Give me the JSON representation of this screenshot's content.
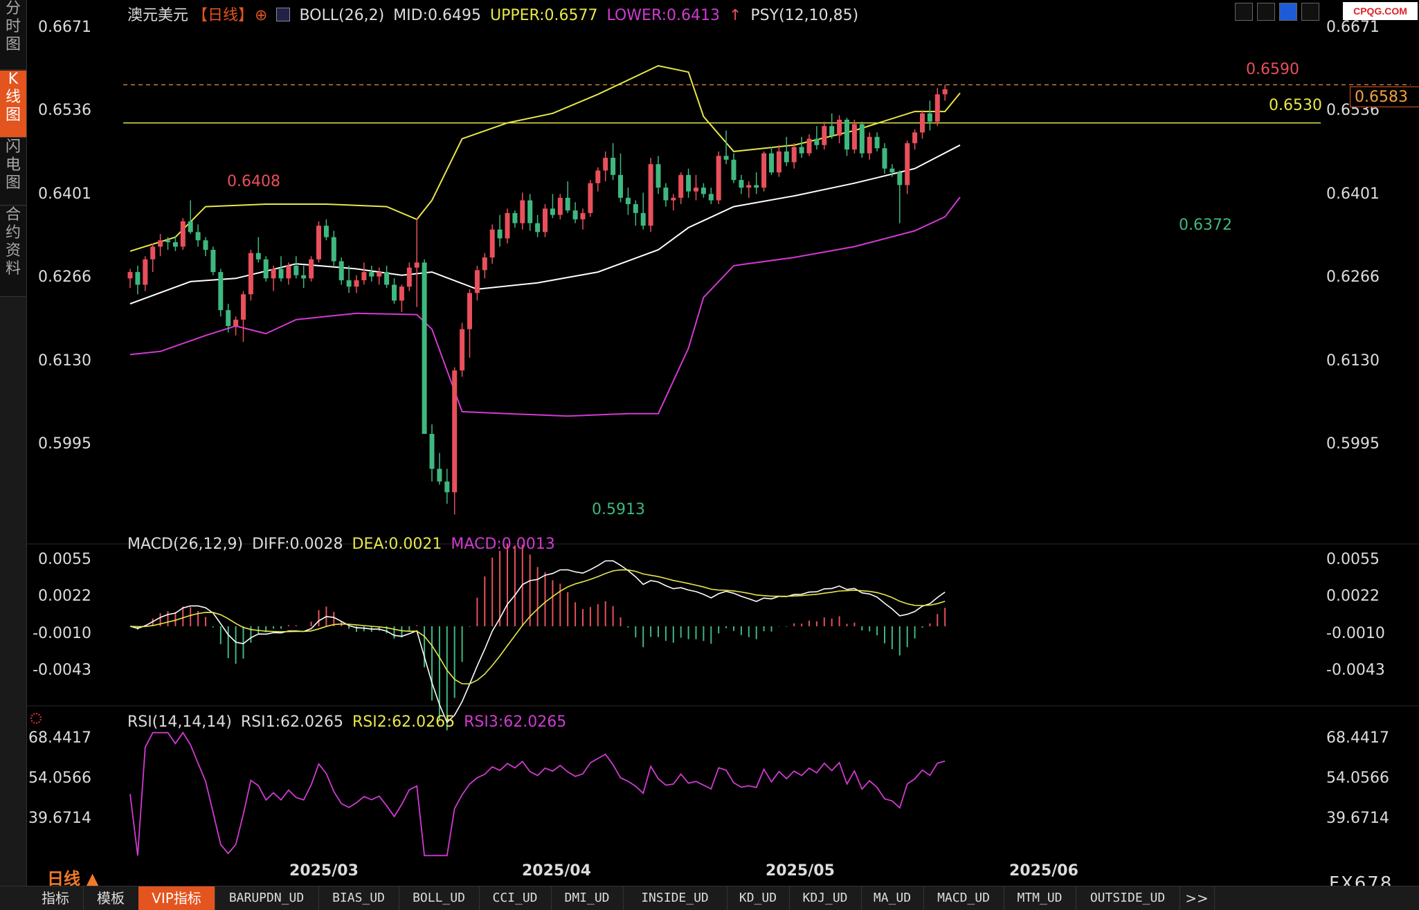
{
  "sidebar": {
    "tabs": [
      {
        "label": "分时图",
        "active": false
      },
      {
        "label": "K线图",
        "active": true
      },
      {
        "label": "闪电图",
        "active": false
      },
      {
        "label": "合约资料",
        "active": false
      }
    ]
  },
  "header": {
    "symbol": "澳元美元",
    "period_tag": "【日线】",
    "indicator_label": "BOLL(26,2)",
    "mid": "MID:0.6495",
    "upper": "UPPER:0.6577",
    "lower": "LOWER:0.6413",
    "psy": "PSY(12,10,85)",
    "logo": "CPQG.COM"
  },
  "price_axis": {
    "ticks": [
      "0.6671",
      "0.6536",
      "0.6401",
      "0.6266",
      "0.6130",
      "0.5995"
    ]
  },
  "annotations": {
    "high_label": "0.6408",
    "low_label": "0.5913",
    "recent_high_label": "0.6590",
    "recent_low_label": "0.6372",
    "hline_label": "0.6530",
    "last_price": "0.6583"
  },
  "macd": {
    "title": "MACD(26,12,9)",
    "diff": "DIFF:0.0028",
    "dea": "DEA:0.0021",
    "macd": "MACD:0.0013",
    "ticks": [
      "0.0055",
      "0.0022",
      "-0.0010",
      "-0.0043"
    ]
  },
  "rsi": {
    "title": "RSI(14,14,14)",
    "rsi1": "RSI1:62.0265",
    "rsi2": "RSI2:62.0265",
    "rsi3": "RSI3:62.0265",
    "ticks": [
      "68.4417",
      "54.0566",
      "39.6714"
    ]
  },
  "dates": [
    "2025/03",
    "2025/04",
    "2025/05",
    "2025/06"
  ],
  "period_label": "日线 ▲",
  "watermark": "FX678",
  "bottom_bar": [
    "指标",
    "模板",
    "VIP指标",
    "BARUPDN_UD",
    "BIAS_UD",
    "BOLL_UD",
    "CCI_UD",
    "DMI_UD",
    "INSIDE_UD",
    "KD_UD",
    "KDJ_UD",
    "MA_UD",
    "MACD_UD",
    "MTM_UD",
    "OUTSIDE_UD",
    ">>"
  ],
  "colors": {
    "up": "#e8505b",
    "down": "#3fb87f",
    "mid": "#ffffff",
    "upper": "#e8e84a",
    "lower": "#d23ad2",
    "accent": "#e4541e"
  },
  "chart_data": {
    "type": "candlestick",
    "price_range": [
      0.5895,
      0.668
    ],
    "candles_ohlc": [
      [
        0.6285,
        0.63,
        0.627,
        0.6295
      ],
      [
        0.6295,
        0.6305,
        0.626,
        0.6275
      ],
      [
        0.6275,
        0.632,
        0.6265,
        0.6315
      ],
      [
        0.6315,
        0.634,
        0.6295,
        0.6335
      ],
      [
        0.6335,
        0.6355,
        0.632,
        0.6345
      ],
      [
        0.6345,
        0.635,
        0.633,
        0.6342
      ],
      [
        0.6342,
        0.6352,
        0.6328,
        0.6335
      ],
      [
        0.6335,
        0.638,
        0.633,
        0.6375
      ],
      [
        0.6375,
        0.6408,
        0.6355,
        0.6358
      ],
      [
        0.6358,
        0.637,
        0.6335,
        0.6345
      ],
      [
        0.6345,
        0.635,
        0.632,
        0.633
      ],
      [
        0.633,
        0.6335,
        0.629,
        0.6295
      ],
      [
        0.6295,
        0.63,
        0.6225,
        0.6235
      ],
      [
        0.6235,
        0.6245,
        0.62,
        0.621
      ],
      [
        0.621,
        0.6225,
        0.6195,
        0.622
      ],
      [
        0.622,
        0.6265,
        0.6185,
        0.626
      ],
      [
        0.626,
        0.633,
        0.625,
        0.6325
      ],
      [
        0.6325,
        0.635,
        0.631,
        0.6315
      ],
      [
        0.6315,
        0.632,
        0.628,
        0.6285
      ],
      [
        0.6285,
        0.6305,
        0.6265,
        0.63
      ],
      [
        0.63,
        0.632,
        0.628,
        0.6285
      ],
      [
        0.6285,
        0.631,
        0.6275,
        0.6305
      ],
      [
        0.6305,
        0.632,
        0.6285,
        0.629
      ],
      [
        0.629,
        0.6305,
        0.627,
        0.6285
      ],
      [
        0.6285,
        0.632,
        0.628,
        0.6315
      ],
      [
        0.6315,
        0.6375,
        0.631,
        0.6368
      ],
      [
        0.6368,
        0.6378,
        0.6345,
        0.635
      ],
      [
        0.635,
        0.636,
        0.6305,
        0.6312
      ],
      [
        0.6312,
        0.6318,
        0.6275,
        0.6282
      ],
      [
        0.6282,
        0.6305,
        0.6262,
        0.6272
      ],
      [
        0.6272,
        0.629,
        0.6262,
        0.6282
      ],
      [
        0.6282,
        0.631,
        0.6275,
        0.6295
      ],
      [
        0.6295,
        0.6305,
        0.628,
        0.6288
      ],
      [
        0.6288,
        0.6302,
        0.6275,
        0.6295
      ],
      [
        0.6295,
        0.6305,
        0.627,
        0.6275
      ],
      [
        0.6275,
        0.6285,
        0.6245,
        0.625
      ],
      [
        0.625,
        0.6275,
        0.6232,
        0.6272
      ],
      [
        0.6272,
        0.631,
        0.6265,
        0.6302
      ],
      [
        0.6302,
        0.638,
        0.624,
        0.631
      ],
      [
        0.631,
        0.6315,
        0.6225,
        0.604
      ],
      [
        0.604,
        0.6055,
        0.5965,
        0.5985
      ],
      [
        0.5985,
        0.601,
        0.596,
        0.5965
      ],
      [
        0.5965,
        0.5985,
        0.593,
        0.5948
      ],
      [
        0.5948,
        0.6145,
        0.5913,
        0.614
      ],
      [
        0.614,
        0.6215,
        0.613,
        0.6205
      ],
      [
        0.6205,
        0.6268,
        0.616,
        0.6262
      ],
      [
        0.6262,
        0.6305,
        0.625,
        0.6298
      ],
      [
        0.6298,
        0.6325,
        0.6285,
        0.6318
      ],
      [
        0.6318,
        0.637,
        0.6308,
        0.6362
      ],
      [
        0.6362,
        0.6385,
        0.6335,
        0.6348
      ],
      [
        0.6348,
        0.6395,
        0.634,
        0.6388
      ],
      [
        0.6388,
        0.6392,
        0.6365,
        0.6372
      ],
      [
        0.6372,
        0.642,
        0.6362,
        0.6408
      ],
      [
        0.6408,
        0.6418,
        0.636,
        0.6372
      ],
      [
        0.6372,
        0.6385,
        0.635,
        0.6358
      ],
      [
        0.6358,
        0.6402,
        0.635,
        0.6395
      ],
      [
        0.6395,
        0.6418,
        0.638,
        0.6385
      ],
      [
        0.6385,
        0.6418,
        0.6378,
        0.6412
      ],
      [
        0.6412,
        0.6438,
        0.6388,
        0.6392
      ],
      [
        0.6392,
        0.6405,
        0.6372,
        0.6378
      ],
      [
        0.6378,
        0.6395,
        0.6362,
        0.6388
      ],
      [
        0.6388,
        0.644,
        0.6382,
        0.6435
      ],
      [
        0.6435,
        0.646,
        0.6422,
        0.6455
      ],
      [
        0.6455,
        0.6485,
        0.6438,
        0.6475
      ],
      [
        0.6475,
        0.6498,
        0.644,
        0.6448
      ],
      [
        0.6448,
        0.6482,
        0.6405,
        0.6412
      ],
      [
        0.6412,
        0.6428,
        0.6385,
        0.6402
      ],
      [
        0.6402,
        0.6408,
        0.6368,
        0.6388
      ],
      [
        0.6388,
        0.642,
        0.6362,
        0.6368
      ],
      [
        0.6368,
        0.6475,
        0.6358,
        0.6465
      ],
      [
        0.6465,
        0.6478,
        0.6418,
        0.6428
      ],
      [
        0.6428,
        0.6435,
        0.6398,
        0.6408
      ],
      [
        0.6408,
        0.6418,
        0.6392,
        0.6412
      ],
      [
        0.6412,
        0.6452,
        0.6402,
        0.6448
      ],
      [
        0.6448,
        0.6458,
        0.6412,
        0.6422
      ],
      [
        0.6422,
        0.6448,
        0.6408,
        0.6428
      ],
      [
        0.6428,
        0.6435,
        0.6412,
        0.6418
      ],
      [
        0.6418,
        0.6428,
        0.6402,
        0.6408
      ],
      [
        0.6408,
        0.6485,
        0.6402,
        0.6478
      ],
      [
        0.6478,
        0.6518,
        0.6465,
        0.6472
      ],
      [
        0.6472,
        0.6482,
        0.6435,
        0.644
      ],
      [
        0.644,
        0.6448,
        0.6418,
        0.6428
      ],
      [
        0.6428,
        0.6438,
        0.6412,
        0.6432
      ],
      [
        0.6432,
        0.6452,
        0.6418,
        0.6428
      ],
      [
        0.6428,
        0.6485,
        0.6422,
        0.6482
      ],
      [
        0.6482,
        0.6492,
        0.6448,
        0.6452
      ],
      [
        0.6452,
        0.6495,
        0.6445,
        0.6485
      ],
      [
        0.6485,
        0.6508,
        0.6462,
        0.6468
      ],
      [
        0.6468,
        0.6498,
        0.6458,
        0.6492
      ],
      [
        0.6492,
        0.6508,
        0.6475,
        0.6482
      ],
      [
        0.6482,
        0.6512,
        0.6478,
        0.6505
      ],
      [
        0.6505,
        0.6525,
        0.6488,
        0.6495
      ],
      [
        0.6495,
        0.6532,
        0.6488,
        0.6525
      ],
      [
        0.6525,
        0.6545,
        0.6505,
        0.651
      ],
      [
        0.651,
        0.6542,
        0.6498,
        0.6535
      ],
      [
        0.6535,
        0.6538,
        0.6478,
        0.6488
      ],
      [
        0.6488,
        0.6535,
        0.6482,
        0.6528
      ],
      [
        0.6528,
        0.6532,
        0.6475,
        0.6482
      ],
      [
        0.6482,
        0.6515,
        0.6472,
        0.6508
      ],
      [
        0.6508,
        0.6515,
        0.6485,
        0.649
      ],
      [
        0.649,
        0.6498,
        0.645,
        0.6458
      ],
      [
        0.6458,
        0.6465,
        0.6445,
        0.6452
      ],
      [
        0.6452,
        0.6455,
        0.6372,
        0.6432
      ],
      [
        0.6432,
        0.6502,
        0.6418,
        0.6498
      ],
      [
        0.6498,
        0.652,
        0.6488,
        0.6515
      ],
      [
        0.6515,
        0.655,
        0.6505,
        0.6545
      ],
      [
        0.6545,
        0.6565,
        0.6518,
        0.6532
      ],
      [
        0.6532,
        0.6585,
        0.6525,
        0.6575
      ],
      [
        0.6575,
        0.659,
        0.6565,
        0.6583
      ]
    ],
    "lines": {
      "mid": [
        [
          0,
          0.6245
        ],
        [
          8,
          0.628
        ],
        [
          14,
          0.6285
        ],
        [
          22,
          0.6308
        ],
        [
          30,
          0.63
        ],
        [
          36,
          0.629
        ],
        [
          40,
          0.6295
        ],
        [
          46,
          0.6268
        ],
        [
          54,
          0.6278
        ],
        [
          62,
          0.6295
        ],
        [
          70,
          0.633
        ],
        [
          74,
          0.6365
        ],
        [
          80,
          0.6398
        ],
        [
          88,
          0.6415
        ],
        [
          96,
          0.6435
        ],
        [
          104,
          0.6458
        ],
        [
          110,
          0.6495
        ]
      ],
      "upper": [
        [
          0,
          0.6328
        ],
        [
          6,
          0.635
        ],
        [
          10,
          0.6398
        ],
        [
          18,
          0.6402
        ],
        [
          26,
          0.6402
        ],
        [
          34,
          0.6398
        ],
        [
          38,
          0.6378
        ],
        [
          40,
          0.6408
        ],
        [
          44,
          0.6505
        ],
        [
          50,
          0.653
        ],
        [
          56,
          0.6545
        ],
        [
          62,
          0.6575
        ],
        [
          70,
          0.662
        ],
        [
          74,
          0.661
        ],
        [
          76,
          0.654
        ],
        [
          80,
          0.6485
        ],
        [
          88,
          0.6495
        ],
        [
          96,
          0.6518
        ],
        [
          104,
          0.6548
        ],
        [
          108,
          0.6548
        ],
        [
          110,
          0.6577
        ]
      ],
      "lower": [
        [
          0,
          0.6165
        ],
        [
          4,
          0.617
        ],
        [
          10,
          0.6195
        ],
        [
          14,
          0.621
        ],
        [
          18,
          0.6198
        ],
        [
          22,
          0.622
        ],
        [
          30,
          0.623
        ],
        [
          38,
          0.6228
        ],
        [
          40,
          0.6205
        ],
        [
          44,
          0.6075
        ],
        [
          50,
          0.6072
        ],
        [
          58,
          0.6068
        ],
        [
          66,
          0.6072
        ],
        [
          70,
          0.6072
        ],
        [
          74,
          0.6175
        ],
        [
          76,
          0.6255
        ],
        [
          80,
          0.6305
        ],
        [
          88,
          0.6318
        ],
        [
          96,
          0.6335
        ],
        [
          104,
          0.636
        ],
        [
          108,
          0.6382
        ],
        [
          110,
          0.6413
        ]
      ]
    },
    "hline_value": 0.653,
    "dashed_value": 0.659
  }
}
